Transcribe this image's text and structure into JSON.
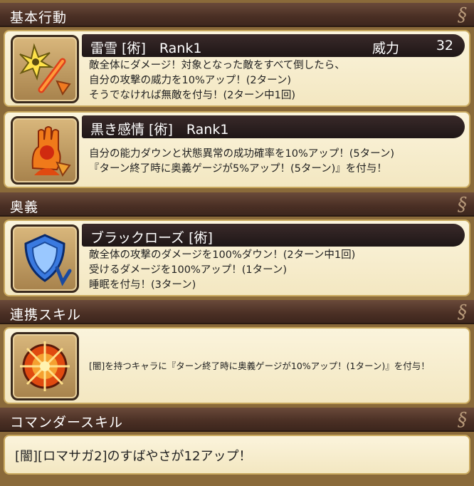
{
  "sections": {
    "basic": "基本行動",
    "ougi": "奥義",
    "link": "連携スキル",
    "commander": "コマンダースキル"
  },
  "swirl": "§",
  "skills": [
    {
      "name": "雷雪 [術]　Rank1",
      "power_label": "威力",
      "power_value": "32",
      "lines": [
        "敵全体にダメージ！対象となった敵をすべて倒したら、",
        "自分の攻撃の威力を10%アップ！(2ターン)",
        "そうでなければ無敵を付与！(2ターン中1回)"
      ],
      "icon": "shuriken-sword-icon"
    },
    {
      "name": "黒き感情 [術]　Rank1",
      "lines": [
        "自分の能力ダウンと状態異常の成功確率を10%アップ！(5ターン)",
        "『ターン終了時に奥義ゲージが5%アップ！(5ターン)』を付与！"
      ],
      "icon": "dark-emotion-icon"
    },
    {
      "name": "ブラックローズ [術]",
      "lines": [
        "敵全体の攻撃のダメージを100%ダウン！(2ターン中1回)",
        "受けるダメージを100%アップ！(1ターン)",
        "睡眠を付与！(3ターン)"
      ],
      "icon": "shield-down-icon"
    }
  ],
  "link_skill": {
    "text": "[闇]を持つキャラに『ターン終了時に奥義ゲージが10%アップ！(1ターン)』を付与！",
    "icon": "dark-sun-icon"
  },
  "commander_skill": {
    "text": "[闇][ロマサガ2]のすばやさが12アップ！"
  },
  "colors": {
    "header_bg": "#4a2f24",
    "card_bg": "#f8efd0",
    "name_bar": "#241a1a",
    "accent_orange": "#f08a20"
  }
}
